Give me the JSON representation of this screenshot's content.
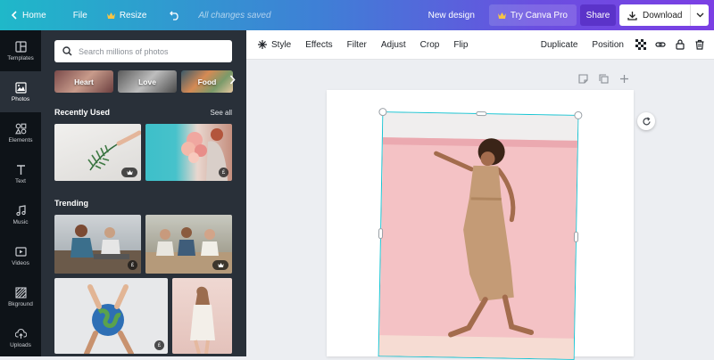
{
  "topbar": {
    "home": "Home",
    "file": "File",
    "resize": "Resize",
    "saved_status": "All changes saved",
    "new_design": "New design",
    "try_pro": "Try Canva Pro",
    "share": "Share",
    "download": "Download"
  },
  "leftnav": {
    "items": [
      {
        "label": "Templates",
        "icon": "templates-icon"
      },
      {
        "label": "Photos",
        "icon": "photos-icon"
      },
      {
        "label": "Elements",
        "icon": "elements-icon"
      },
      {
        "label": "Text",
        "icon": "text-icon"
      },
      {
        "label": "Music",
        "icon": "music-icon"
      },
      {
        "label": "Videos",
        "icon": "videos-icon"
      },
      {
        "label": "Bkground",
        "icon": "background-icon"
      },
      {
        "label": "Uploads",
        "icon": "uploads-icon"
      }
    ],
    "active": "Photos"
  },
  "panel": {
    "search_placeholder": "Search millions of photos",
    "chips": [
      "Heart",
      "Love",
      "Food"
    ],
    "recently_used_title": "Recently Used",
    "see_all": "See all",
    "trending_title": "Trending",
    "badge_pound": "£"
  },
  "toolbar": {
    "style": "Style",
    "effects": "Effects",
    "filter": "Filter",
    "adjust": "Adjust",
    "crop": "Crop",
    "flip": "Flip",
    "duplicate": "Duplicate",
    "position": "Position"
  },
  "colors": {
    "selection": "#18c5d3",
    "share_bg": "#5b33c9",
    "panel_bg": "#293039",
    "nav_bg": "#0e1318"
  }
}
